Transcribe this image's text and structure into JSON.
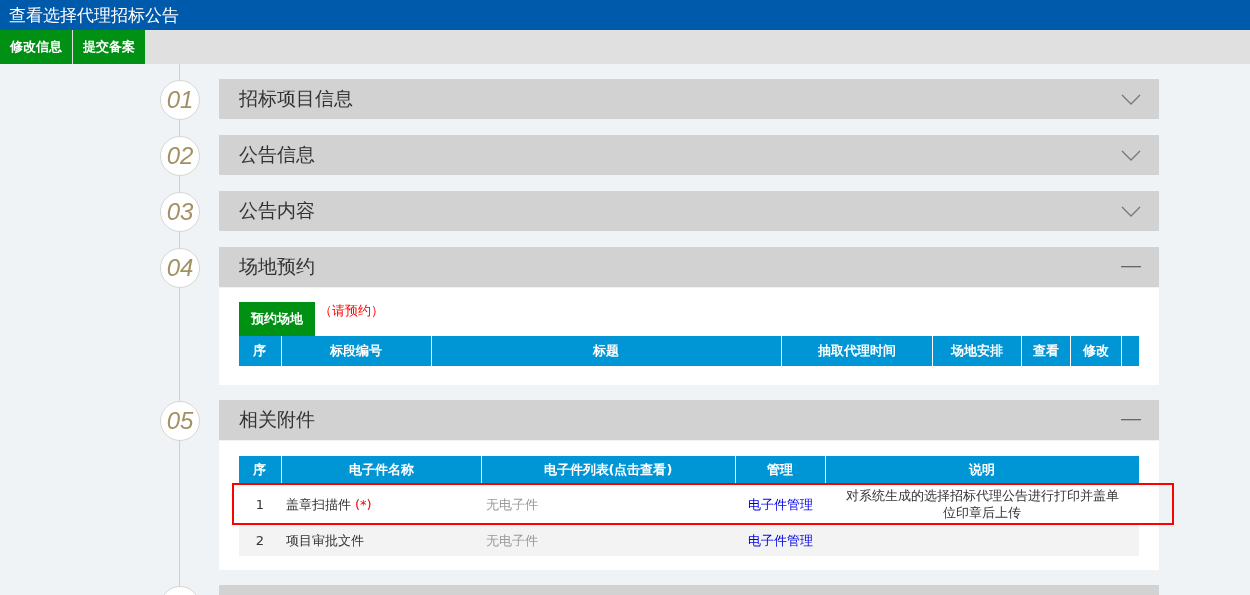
{
  "window": {
    "title": "查看选择代理招标公告"
  },
  "toolbar": [
    "修改信息",
    "提交备案"
  ],
  "sections": [
    {
      "number": "01",
      "title": "招标项目信息",
      "expanded": false
    },
    {
      "number": "02",
      "title": "公告信息",
      "expanded": false
    },
    {
      "number": "03",
      "title": "公告内容",
      "expanded": false
    },
    {
      "number": "04",
      "title": "场地预约",
      "expanded": true,
      "kind": "booking",
      "button": "预约场地",
      "note": "（请预约）",
      "table": {
        "columns": [
          "序",
          "标段编号",
          "标题",
          "抽取代理时间",
          "场地安排",
          "查看",
          "修改",
          ""
        ]
      }
    },
    {
      "number": "05",
      "title": "相关附件",
      "expanded": true,
      "kind": "attachments",
      "table": {
        "columns": [
          "序",
          "电子件名称",
          "电子件列表(点击查看)",
          "管理",
          "说明"
        ],
        "rows": [
          {
            "index": "1",
            "name": "盖章扫描件",
            "required_mark": "(*)",
            "files": "无电子件",
            "manage": "电子件管理",
            "description": "对系统生成的选择招标代理公告进行打印并盖单位印章后上传",
            "highlighted": true
          },
          {
            "index": "2",
            "name": "项目审批文件",
            "files": "无电子件",
            "manage": "电子件管理",
            "highlighted": false
          }
        ]
      }
    },
    {
      "kind": "cut"
    }
  ]
}
